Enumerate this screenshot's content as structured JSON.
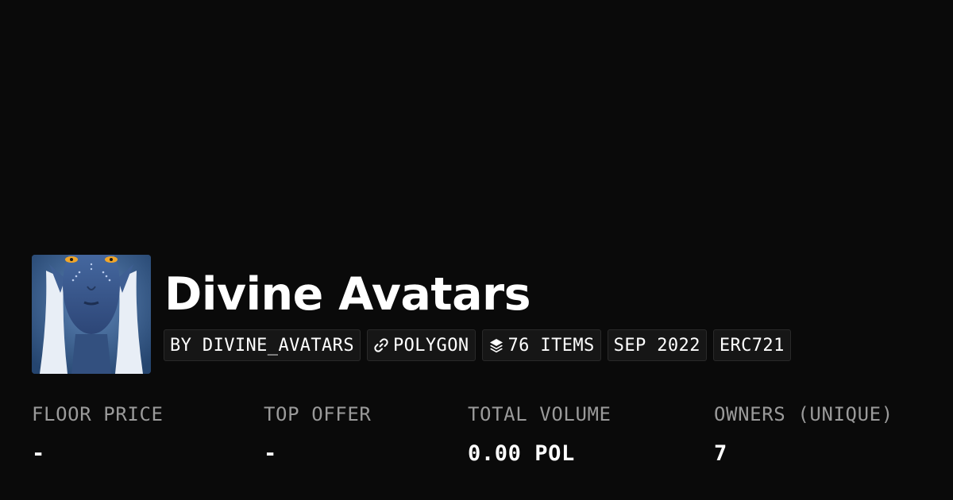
{
  "collection": {
    "name": "Divine Avatars",
    "avatar_icon": "collection-avatar-image"
  },
  "badges": {
    "creator": "BY DIVINE_AVATARS",
    "chain": "POLYGON",
    "chain_icon": "chain-link-icon",
    "items": "76 ITEMS",
    "items_icon": "layers-icon",
    "date": "SEP 2022",
    "standard": "ERC721"
  },
  "stats": {
    "floor_price": {
      "label": "FLOOR PRICE",
      "value": "-"
    },
    "top_offer": {
      "label": "TOP OFFER",
      "value": "-"
    },
    "total_volume": {
      "label": "TOTAL VOLUME",
      "value": "0.00 POL"
    },
    "owners": {
      "label": "OWNERS (UNIQUE)",
      "value": "7"
    }
  },
  "colors": {
    "background": "#0a0a0a",
    "badge_background": "#161616",
    "label_gray": "#9a9a9a",
    "text": "#ffffff"
  }
}
